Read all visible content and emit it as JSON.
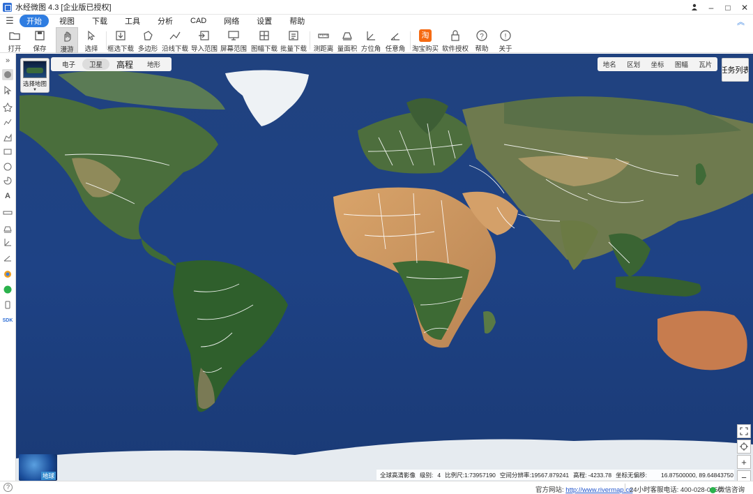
{
  "window": {
    "title": "水经微图 4.3 [企业版已授权]",
    "controls": [
      "person-icon",
      "minimize-icon",
      "maximize-icon",
      "close-icon"
    ]
  },
  "menubar": {
    "items": [
      "开始",
      "视图",
      "下载",
      "工具",
      "分析",
      "CAD",
      "网络",
      "设置",
      "帮助"
    ],
    "active_index": 0,
    "accent": "#2f7de1"
  },
  "toolbar": {
    "items": [
      {
        "label": "打开",
        "icon": "folder-icon",
        "has_dropdown": true
      },
      {
        "label": "保存",
        "icon": "save-icon"
      },
      {
        "label": "漫游",
        "icon": "hand-icon",
        "active": true
      },
      {
        "label": "选择",
        "icon": "cursor-icon"
      },
      {
        "label": "框选下载",
        "icon": "rect-download-icon"
      },
      {
        "label": "多边形",
        "icon": "polygon-download-icon"
      },
      {
        "label": "沿线下载",
        "icon": "line-download-icon"
      },
      {
        "label": "导入范围",
        "icon": "import-range-icon"
      },
      {
        "label": "屏幕范围",
        "icon": "screen-range-icon"
      },
      {
        "label": "图幅下载",
        "icon": "sheet-download-icon",
        "has_dropdown": true
      },
      {
        "label": "批量下载",
        "icon": "batch-download-icon"
      },
      {
        "label": "测距离",
        "icon": "ruler-icon"
      },
      {
        "label": "量面积",
        "icon": "area-icon"
      },
      {
        "label": "方位角",
        "icon": "azimuth-icon"
      },
      {
        "label": "任意角",
        "icon": "angle-icon"
      },
      {
        "label": "淘宝购买",
        "icon": "taobao-icon"
      },
      {
        "label": "软件授权",
        "icon": "lock-icon"
      },
      {
        "label": "帮助",
        "icon": "help-icon"
      },
      {
        "label": "关于",
        "icon": "info-icon"
      }
    ],
    "taobao_glyph": "淘"
  },
  "leftbar": {
    "expand_glyph": "»",
    "sdk_label": "SDK",
    "tools": [
      "roam-icon",
      "select-icon",
      "point-icon",
      "polyline-icon",
      "area-icon",
      "rectangle-icon",
      "circle-icon",
      "sector-icon",
      "text-icon",
      "ruler-icon",
      "area-measure-icon",
      "azimuth-icon",
      "angle-icon",
      "layer-icon",
      "plugin-icon",
      "phone-icon",
      "sdk-icon"
    ]
  },
  "map": {
    "basemap_select_label": "选择地图",
    "map_types": [
      "电子",
      "卫星",
      "高程",
      "地形"
    ],
    "selected_map_type_index": 1,
    "layer_tabs": [
      "地名",
      "区划",
      "坐标",
      "图幅",
      "瓦片"
    ],
    "task_list_label": "任务列表",
    "zoom_controls": [
      "fullscreen-icon",
      "locate-icon",
      "zoom-in-icon",
      "zoom-out-icon"
    ],
    "zoom_in": "+",
    "zoom_out": "−",
    "globe_label": "地球",
    "ocean_color": "#1c3f7e",
    "land_color": "#3d6b3a",
    "desert_color": "#c8955a"
  },
  "map_status": {
    "source": "全球高清影像",
    "level_label": "级别:",
    "level": "4",
    "scale_label": "比例尺:",
    "scale": "1:73957190",
    "resolution_label": "空间分辨率:",
    "resolution": "19567.879241",
    "elevation_label": "高程:",
    "elevation": "-4233.78",
    "coord_offset_label": "坐标无偏移:",
    "coordinates": "16.87500000, 89.64843750"
  },
  "statusbar": {
    "help_glyph": "?",
    "site_label": "官方网站:",
    "site_url": "http://www.rivermap.cn",
    "phone": "24小时客服电话: 400-028-0050",
    "wechat": "微信咨询"
  }
}
